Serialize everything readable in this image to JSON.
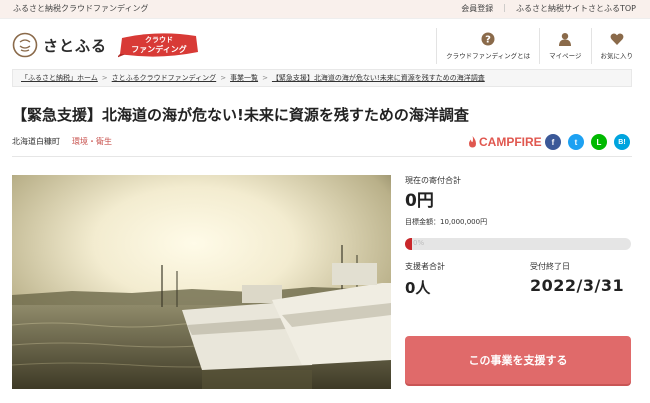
{
  "topbar": {
    "tagline": "ふるさと納税クラウドファンディング",
    "links": [
      "会員登録",
      "ふるさと納税サイトさとふるTOP"
    ]
  },
  "header": {
    "logo_mark": "さとふる",
    "logo_text": "さとふる",
    "badge_line1": "クラウド",
    "badge_line2": "ファンディング",
    "nav": [
      {
        "label": "クラウドファンディングとは",
        "icon": "question-icon"
      },
      {
        "label": "マイページ",
        "icon": "user-icon"
      },
      {
        "label": "お気に入り",
        "icon": "heart-icon"
      }
    ]
  },
  "breadcrumb": {
    "items": [
      "「ふるさと納税」ホーム",
      "さとふるクラウドファンディング",
      "事業一覧",
      "【緊急支援】北海道の海が危ない!未来に資源を残すための海洋調査"
    ],
    "separator": ">"
  },
  "project": {
    "title": "【緊急支援】北海道の海が危ない!未来に資源を残すための海洋調査",
    "town": "北海道白糠町",
    "category": "環境・衛生",
    "platform": "CAMPFIRE"
  },
  "share": {
    "facebook": "f",
    "twitter": "t",
    "line": "L",
    "hatena": "B!"
  },
  "stats": {
    "current_label": "現在の寄付合計",
    "current_value": "0円",
    "goal_text": "目標金額：10,000,000円",
    "progress_percent_text": "0%",
    "progress_fraction": 0.03,
    "supporters_label": "支援者合計",
    "supporters_value": "0人",
    "deadline_label": "受付終了日",
    "deadline_value": "2022/3/31"
  },
  "cta": {
    "support_label": "この事業を支援する"
  },
  "colors": {
    "brand_red": "#c8524e",
    "cta": "#e06a6a",
    "progress_fill": "#c9272a",
    "campfire": "#e0574f",
    "facebook": "#3b5998",
    "twitter": "#1da1f2",
    "line": "#00b900",
    "hatena": "#00a4de"
  }
}
